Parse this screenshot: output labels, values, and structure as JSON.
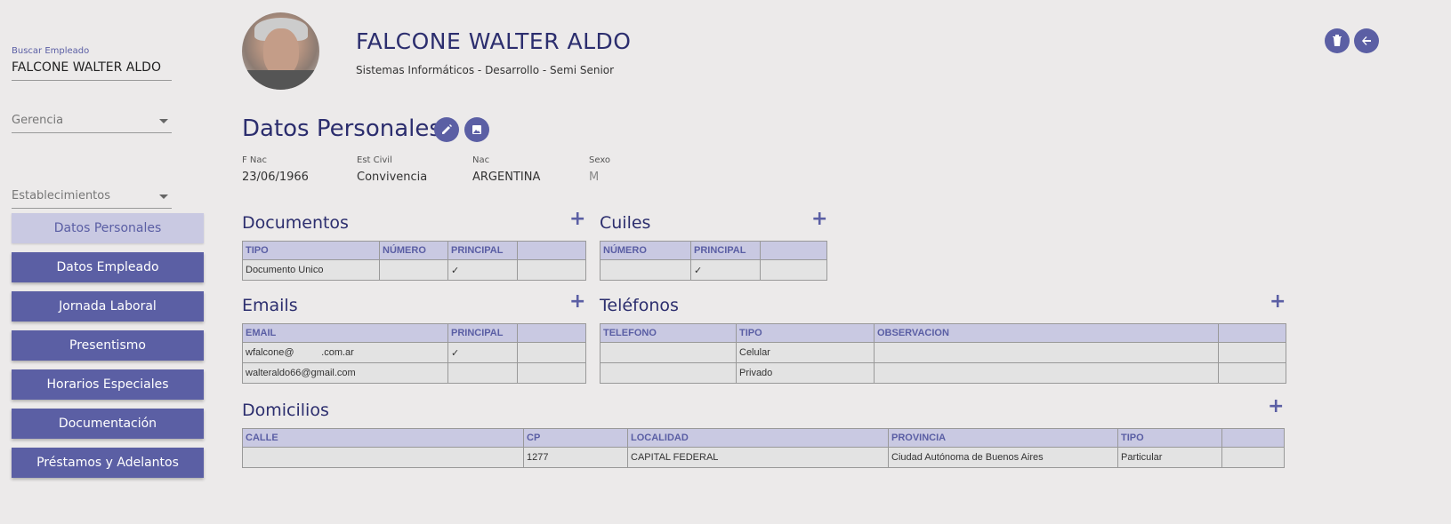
{
  "sidebar": {
    "search_label": "Buscar Empleado",
    "search_value": "FALCONE WALTER ALDO",
    "gerencia_placeholder": "Gerencia",
    "establecimientos_placeholder": "Establecimientos",
    "nav": [
      {
        "label": "Datos Personales",
        "active": true
      },
      {
        "label": "Datos Empleado"
      },
      {
        "label": "Jornada Laboral"
      },
      {
        "label": "Presentismo"
      },
      {
        "label": "Horarios Especiales"
      },
      {
        "label": "Documentación"
      },
      {
        "label": "Préstamos y Adelantos"
      }
    ]
  },
  "header": {
    "name": "FALCONE WALTER ALDO",
    "subtitle": "Sistemas Informáticos - Desarrollo - Semi Senior",
    "delete_icon": "trash-icon",
    "back_icon": "arrow-left-icon"
  },
  "personal": {
    "title": "Datos Personales",
    "fields": {
      "fnac_label": "F Nac",
      "fnac_value": "23/06/1966",
      "estcivil_label": "Est Civil",
      "estcivil_value": "Convivencia",
      "nac_label": "Nac",
      "nac_value": "ARGENTINA",
      "sexo_label": "Sexo",
      "sexo_value": "M"
    }
  },
  "documentos": {
    "title": "Documentos",
    "headers": [
      "TIPO",
      "NÚMERO",
      "PRINCIPAL",
      ""
    ],
    "rows": [
      [
        "Documento Unico",
        "",
        "✓",
        ""
      ]
    ]
  },
  "cuiles": {
    "title": "Cuiles",
    "headers": [
      "NÚMERO",
      "PRINCIPAL",
      ""
    ],
    "rows": [
      [
        "",
        "✓",
        ""
      ]
    ]
  },
  "emails": {
    "title": "Emails",
    "headers": [
      "EMAIL",
      "PRINCIPAL",
      ""
    ],
    "rows": [
      [
        "wfalcone@          .com.ar",
        "✓",
        ""
      ],
      [
        "walteraldo66@gmail.com",
        "",
        ""
      ]
    ]
  },
  "telefonos": {
    "title": "Teléfonos",
    "headers": [
      "TELEFONO",
      "TIPO",
      "OBSERVACION",
      ""
    ],
    "rows": [
      [
        "",
        "Celular",
        "",
        ""
      ],
      [
        "",
        "Privado",
        "",
        ""
      ]
    ]
  },
  "domicilios": {
    "title": "Domicilios",
    "headers": [
      "CALLE",
      "CP",
      "LOCALIDAD",
      "PROVINCIA",
      "TIPO",
      ""
    ],
    "rows": [
      [
        "",
        "1277",
        "CAPITAL FEDERAL",
        "Ciudad Autónoma de Buenos Aires",
        "Particular",
        ""
      ]
    ]
  },
  "colors": {
    "primary": "#5b5fa4",
    "header_bg": "#c9c9e2",
    "title": "#2c2e6e"
  }
}
